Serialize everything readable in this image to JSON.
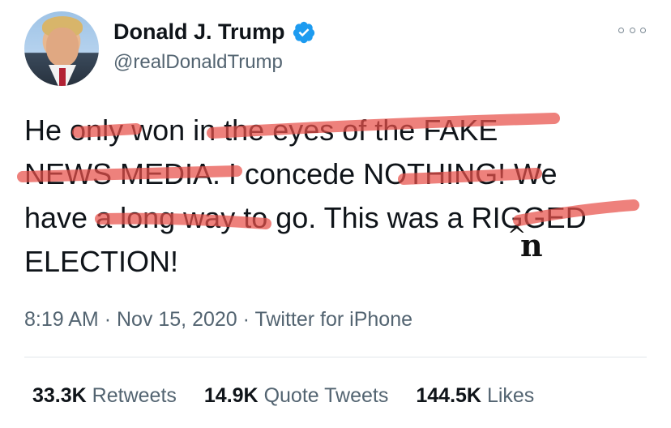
{
  "author": {
    "display_name": "Donald J. Trump",
    "handle": "@realDonaldTrump",
    "verified": true
  },
  "tweet": {
    "lines": [
      [
        "He ",
        "only",
        " won",
        " in the eyes of the FAKE"
      ],
      [
        "NEWS MEDIA",
        ". I concede ",
        "NOTHING",
        "! We"
      ],
      [
        "have",
        " a long way",
        " to go. This was a",
        " RIGGED"
      ],
      [
        "ELECTION!"
      ]
    ],
    "handwritten_insert": "n",
    "caret": "^"
  },
  "meta": {
    "time": "8:19 AM",
    "date": "Nov 15, 2020",
    "source": "Twitter for iPhone",
    "separator": "·"
  },
  "stats": {
    "retweets_count": "33.3K",
    "retweets_label": "Retweets",
    "quote_count": "14.9K",
    "quote_label": "Quote Tweets",
    "likes_count": "144.5K",
    "likes_label": "Likes"
  },
  "colors": {
    "highlight": "#e8504a",
    "verified": "#1d9bf0",
    "secondary_text": "#536471"
  }
}
